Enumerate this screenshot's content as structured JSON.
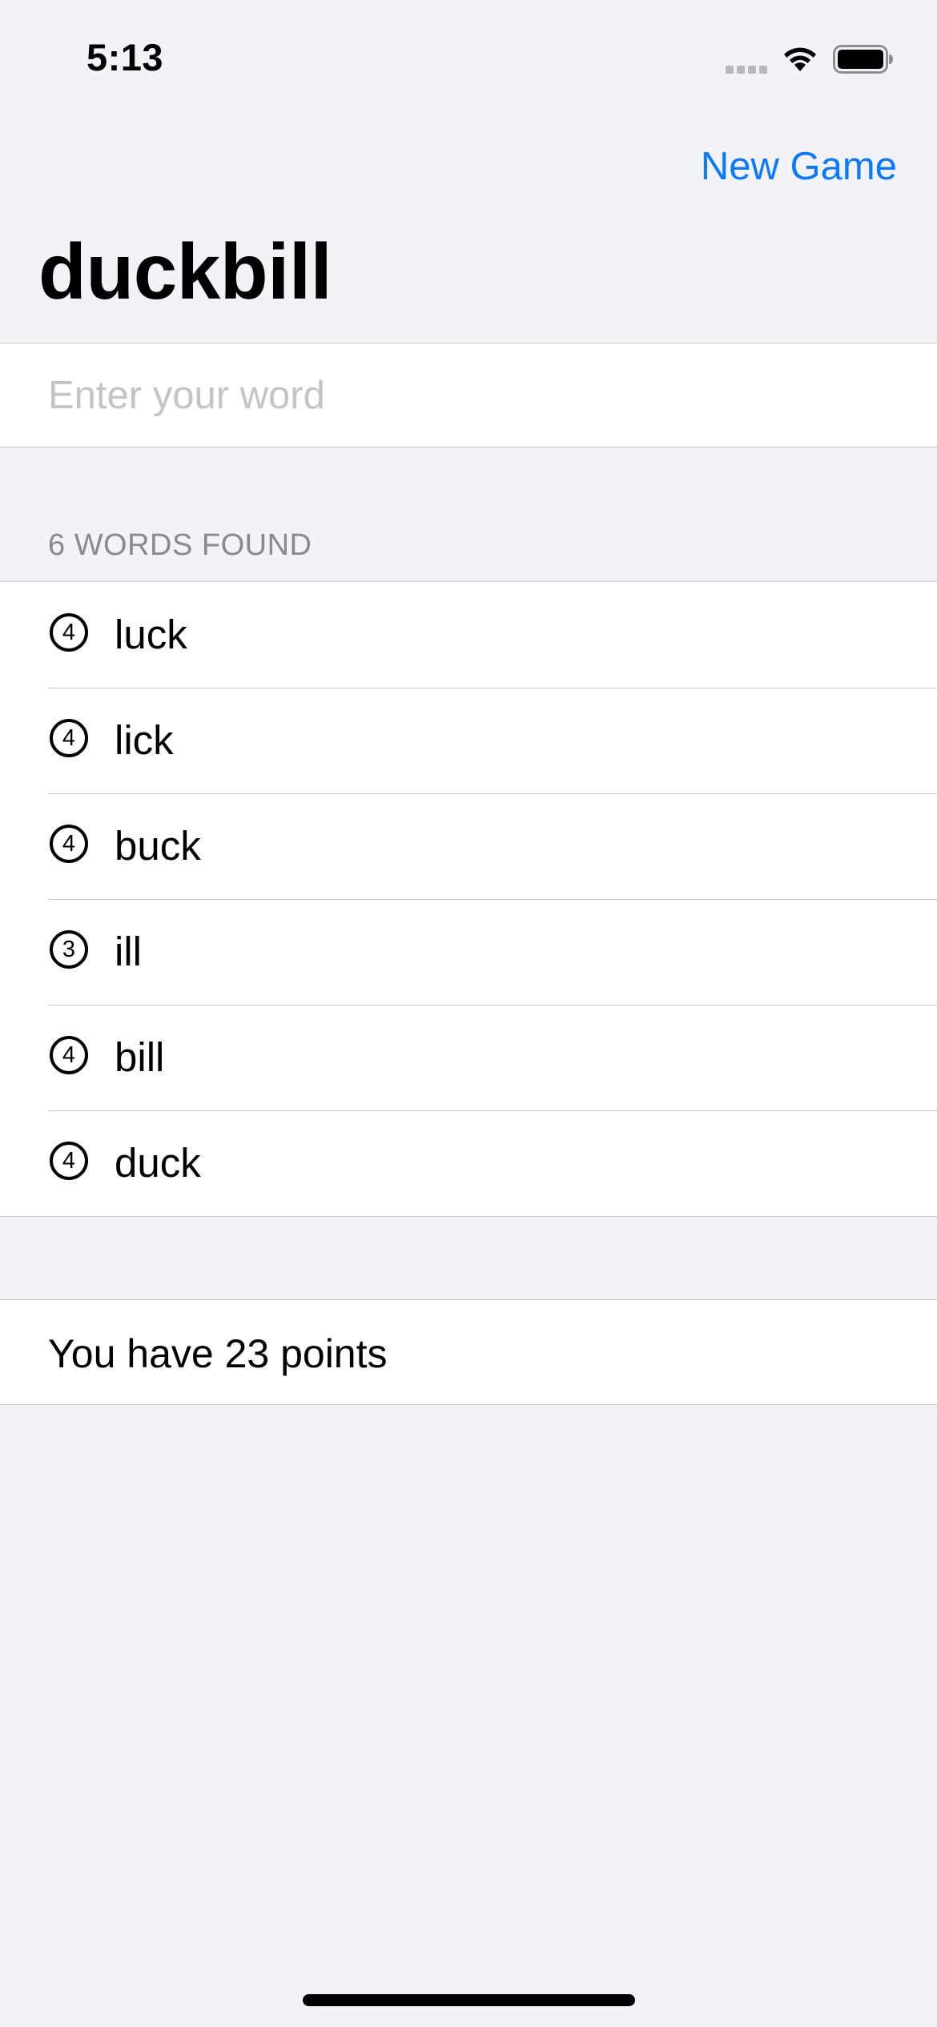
{
  "status_bar": {
    "time": "5:13",
    "icons": [
      "cellular-signal-icon",
      "wifi-icon",
      "battery-icon"
    ]
  },
  "nav": {
    "action_label": "New Game"
  },
  "title": "duckbill",
  "input": {
    "placeholder": "Enter your word",
    "value": ""
  },
  "words_section": {
    "header": "6 WORDS FOUND",
    "items": [
      {
        "score": "4",
        "word": "luck"
      },
      {
        "score": "4",
        "word": "lick"
      },
      {
        "score": "4",
        "word": "buck"
      },
      {
        "score": "3",
        "word": "ill"
      },
      {
        "score": "4",
        "word": "bill"
      },
      {
        "score": "4",
        "word": "duck"
      }
    ]
  },
  "points_text": "You have 23 points",
  "colors": {
    "accent": "#0a7aff",
    "background": "#f2f2f7",
    "cell": "#ffffff",
    "separator": "#c6c6c8",
    "secondary_text": "#8a8a8e"
  }
}
